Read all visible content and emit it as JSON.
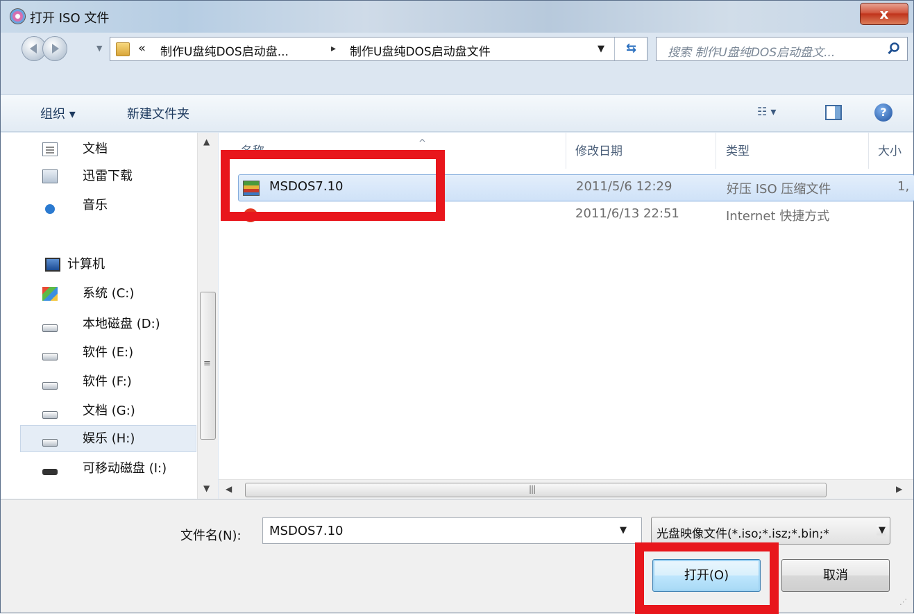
{
  "window": {
    "title": "打开 ISO 文件",
    "close_label": "x"
  },
  "address": {
    "overflow_chevron": "«",
    "crumb_parent": "制作U盘纯DOS启动盘...",
    "crumb_separator": "▸",
    "crumb_current": "制作U盘纯DOS启动盘文件",
    "search_placeholder": "搜索 制作U盘纯DOS启动盘文..."
  },
  "toolbar": {
    "organize": "组织 ▾",
    "new_folder": "新建文件夹"
  },
  "navpane": {
    "items": [
      {
        "label": "文档",
        "icon": "document-icon"
      },
      {
        "label": "迅雷下载",
        "icon": "download-folder-icon"
      },
      {
        "label": "音乐",
        "icon": "music-icon"
      },
      {
        "label": "计算机",
        "icon": "computer-icon"
      },
      {
        "label": "系统 (C:)",
        "icon": "system-drive-icon"
      },
      {
        "label": "本地磁盘 (D:)",
        "icon": "drive-icon"
      },
      {
        "label": "软件 (E:)",
        "icon": "drive-icon"
      },
      {
        "label": "软件 (F:)",
        "icon": "drive-icon"
      },
      {
        "label": "文档 (G:)",
        "icon": "drive-icon"
      },
      {
        "label": "娱乐 (H:)",
        "icon": "drive-icon"
      },
      {
        "label": "可移动磁盘 (I:)",
        "icon": "removable-drive-icon"
      }
    ],
    "selected": "娱乐 (H:)"
  },
  "filelist": {
    "columns": {
      "name": "名称",
      "date": "修改日期",
      "type": "类型",
      "size": "大小"
    },
    "rows": [
      {
        "name": "MSDOS7.10",
        "date": "2011/5/6 12:29",
        "type": "好压 ISO 压缩文件",
        "size": "1,",
        "icon": "iso-archive-icon",
        "selected": true
      },
      {
        "name": "",
        "date": "2011/6/13 22:51",
        "type": "Internet 快捷方式",
        "size": "",
        "icon": "internet-shortcut-icon",
        "selected": false
      }
    ]
  },
  "bottom": {
    "filename_label": "文件名(N):",
    "filename_value": "MSDOS7.10",
    "filetype_value": "光盘映像文件(*.iso;*.isz;*.bin;*",
    "open_button": "打开(O)",
    "cancel_button": "取消"
  },
  "colors": {
    "highlight": "#e8161c",
    "selection": "#cfe2f8",
    "close_button": "#c0331c"
  }
}
